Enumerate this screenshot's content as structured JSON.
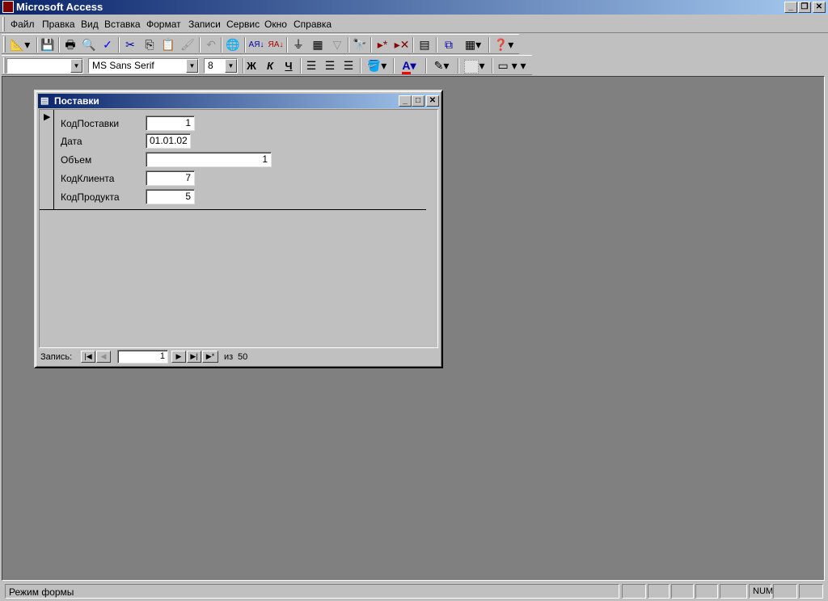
{
  "app": {
    "title": "Microsoft Access"
  },
  "menu": [
    "Файл",
    "Правка",
    "Вид",
    "Вставка",
    "Формат",
    "Записи",
    "Сервис",
    "Окно",
    "Справка"
  ],
  "toolbar_formatting": {
    "object_combo": "",
    "font": "MS Sans Serif",
    "size": "8",
    "bold": "Ж",
    "italic": "К",
    "underline": "Ч",
    "font_color": "#ff0000"
  },
  "form": {
    "title": "Поставки",
    "fields": [
      {
        "label": "КодПоставки",
        "value": "1"
      },
      {
        "label": "Дата",
        "value": "01.01.02"
      },
      {
        "label": "Объем",
        "value": "1"
      },
      {
        "label": "КодКлиента",
        "value": "7"
      },
      {
        "label": "КодПродукта",
        "value": "5"
      }
    ],
    "nav": {
      "label": "Запись:",
      "current": "1",
      "of": "из",
      "total": "50"
    }
  },
  "status": {
    "text": "Режим формы",
    "num": "NUM"
  }
}
